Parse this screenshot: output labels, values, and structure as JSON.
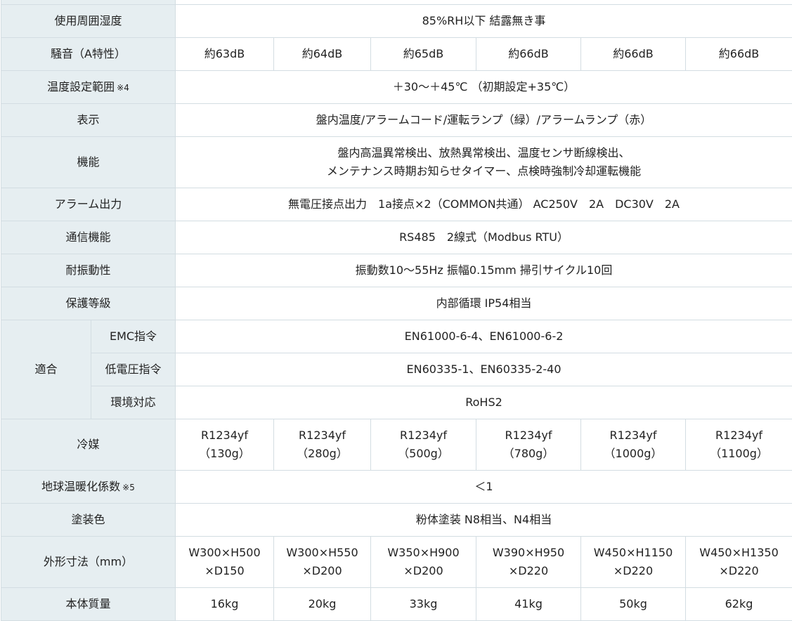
{
  "rows": {
    "humidity": {
      "label": "使用周囲湿度",
      "value": "85%RH以下 結露無き事"
    },
    "noise": {
      "label": "騒音（A特性）",
      "values": [
        "約63dB",
        "約64dB",
        "約65dB",
        "約66dB",
        "約66dB",
        "約66dB"
      ]
    },
    "temp_range": {
      "label": "温度設定範囲",
      "note": "※4",
      "value": "＋30～＋45℃ （初期設定+35℃）"
    },
    "display": {
      "label": "表示",
      "value": "盤内温度/アラームコード/運転ランプ（緑）/アラームランプ（赤）"
    },
    "function": {
      "label": "機能",
      "line1": "盤内高温異常検出、放熱異常検出、温度センサ断線検出、",
      "line2": "メンテナンス時期お知らせタイマー、点検時強制冷却運転機能"
    },
    "alarm": {
      "label": "アラーム出力",
      "value": "無電圧接点出力　1a接点×2（COMMON共通） AC250V　2A　DC30V　2A"
    },
    "comm": {
      "label": "通信機能",
      "value": "RS485　2線式（Modbus RTU）"
    },
    "vibration": {
      "label": "耐振動性",
      "value": "振動数10～55Hz 振幅0.15mm 掃引サイクル10回"
    },
    "protection": {
      "label": "保護等級",
      "value": "内部循環 IP54相当"
    },
    "compliance": {
      "label": "適合",
      "emc": {
        "label": "EMC指令",
        "value": "EN61000-6-4、EN61000-6-2"
      },
      "lv": {
        "label": "低電圧指令",
        "value": "EN60335-1、EN60335-2-40"
      },
      "env": {
        "label": "環境対応",
        "value": "RoHS2"
      }
    },
    "refrigerant": {
      "label": "冷媒",
      "name": "R1234yf",
      "amounts": [
        "（130g）",
        "（280g）",
        "（500g）",
        "（780g）",
        "（1000g）",
        "（1100g）"
      ]
    },
    "gwp": {
      "label": "地球温暖化係数",
      "note": "※5",
      "value": "＜1"
    },
    "paint": {
      "label": "塗装色",
      "value": "粉体塗装 N8相当、N4相当"
    },
    "dimensions": {
      "label": "外形寸法（mm）",
      "line1": [
        "W300×H500",
        "W300×H550",
        "W350×H900",
        "W390×H950",
        "W450×H1150",
        "W450×H1350"
      ],
      "line2": [
        "×D150",
        "×D200",
        "×D200",
        "×D220",
        "×D220",
        "×D220"
      ]
    },
    "mass": {
      "label": "本体質量",
      "values": [
        "16kg",
        "20kg",
        "33kg",
        "41kg",
        "50kg",
        "62kg"
      ]
    }
  }
}
